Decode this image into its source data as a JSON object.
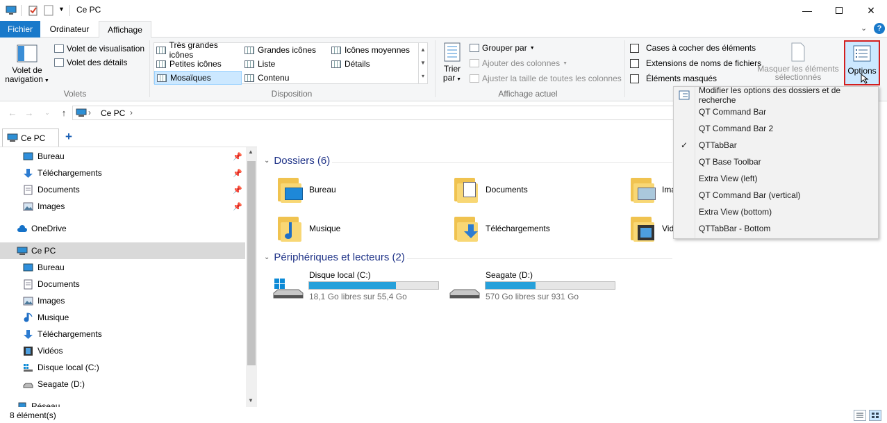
{
  "window": {
    "title": "Ce PC"
  },
  "tabs": {
    "file": "Fichier",
    "computer": "Ordinateur",
    "view": "Affichage"
  },
  "ribbon": {
    "panes": {
      "nav_pane_line1": "Volet de",
      "nav_pane_line2": "navigation",
      "preview": "Volet de visualisation",
      "details": "Volet des détails",
      "label": "Volets"
    },
    "layout": {
      "items": [
        "Très grandes icônes",
        "Grandes icônes",
        "Icônes moyennes",
        "Petites icônes",
        "Liste",
        "Détails",
        "Mosaïques",
        "Contenu"
      ],
      "label": "Disposition"
    },
    "current_view": {
      "sort_line1": "Trier",
      "sort_line2": "par",
      "group_by": "Grouper par",
      "add_columns": "Ajouter des colonnes",
      "fit_columns": "Ajuster la taille de toutes les colonnes",
      "label": "Affichage actuel"
    },
    "show_hide": {
      "checkboxes": "Cases à cocher des éléments",
      "extensions": "Extensions de noms de fichiers",
      "hidden": "Éléments masqués",
      "hide_selected_line1": "Masquer les éléments",
      "hide_selected_line2": "sélectionnés"
    },
    "options": "Options"
  },
  "address": {
    "path": "Ce PC",
    "separator": "›"
  },
  "qtab": {
    "label": "Ce PC",
    "add": "+"
  },
  "nav": {
    "quick": [
      {
        "label": "Bureau"
      },
      {
        "label": "Téléchargements"
      },
      {
        "label": "Documents"
      },
      {
        "label": "Images"
      }
    ],
    "onedrive": "OneDrive",
    "thispc": "Ce PC",
    "pc_items": [
      {
        "label": "Bureau"
      },
      {
        "label": "Documents"
      },
      {
        "label": "Images"
      },
      {
        "label": "Musique"
      },
      {
        "label": "Téléchargements"
      },
      {
        "label": "Vidéos"
      },
      {
        "label": "Disque local (C:)"
      },
      {
        "label": "Seagate (D:)"
      }
    ],
    "network": "Réseau"
  },
  "content": {
    "folders_header": "Dossiers (6)",
    "folders": [
      {
        "name": "Bureau"
      },
      {
        "name": "Documents"
      },
      {
        "name": "Ima"
      },
      {
        "name": "Musique"
      },
      {
        "name": "Téléchargements"
      },
      {
        "name": "Vid"
      }
    ],
    "devices_header": "Périphériques et lecteurs (2)",
    "drives": [
      {
        "name": "Disque local (C:)",
        "free": "18,1 Go libres sur 55,4 Go",
        "used_fraction": 0.673
      },
      {
        "name": "Seagate (D:)",
        "free": "570 Go libres sur 931 Go",
        "used_fraction": 0.388
      }
    ]
  },
  "menu": {
    "items": [
      {
        "label": "Modifier les options des dossiers et de recherche",
        "checked": false
      },
      {
        "label": "QT Command Bar",
        "checked": false
      },
      {
        "label": "QT Command Bar 2",
        "checked": false
      },
      {
        "label": "QTTabBar",
        "checked": true
      },
      {
        "label": "QT Base Toolbar",
        "checked": false
      },
      {
        "label": "Extra View (left)",
        "checked": false
      },
      {
        "label": "QT Command Bar (vertical)",
        "checked": false
      },
      {
        "label": "Extra View (bottom)",
        "checked": false
      },
      {
        "label": "QTTabBar - Bottom",
        "checked": false
      }
    ]
  },
  "status": {
    "count": "8 élément(s)"
  },
  "colors": {
    "accent": "#1979ca",
    "highlight": "#d21f1f",
    "drive_fill": "#26a0da"
  }
}
